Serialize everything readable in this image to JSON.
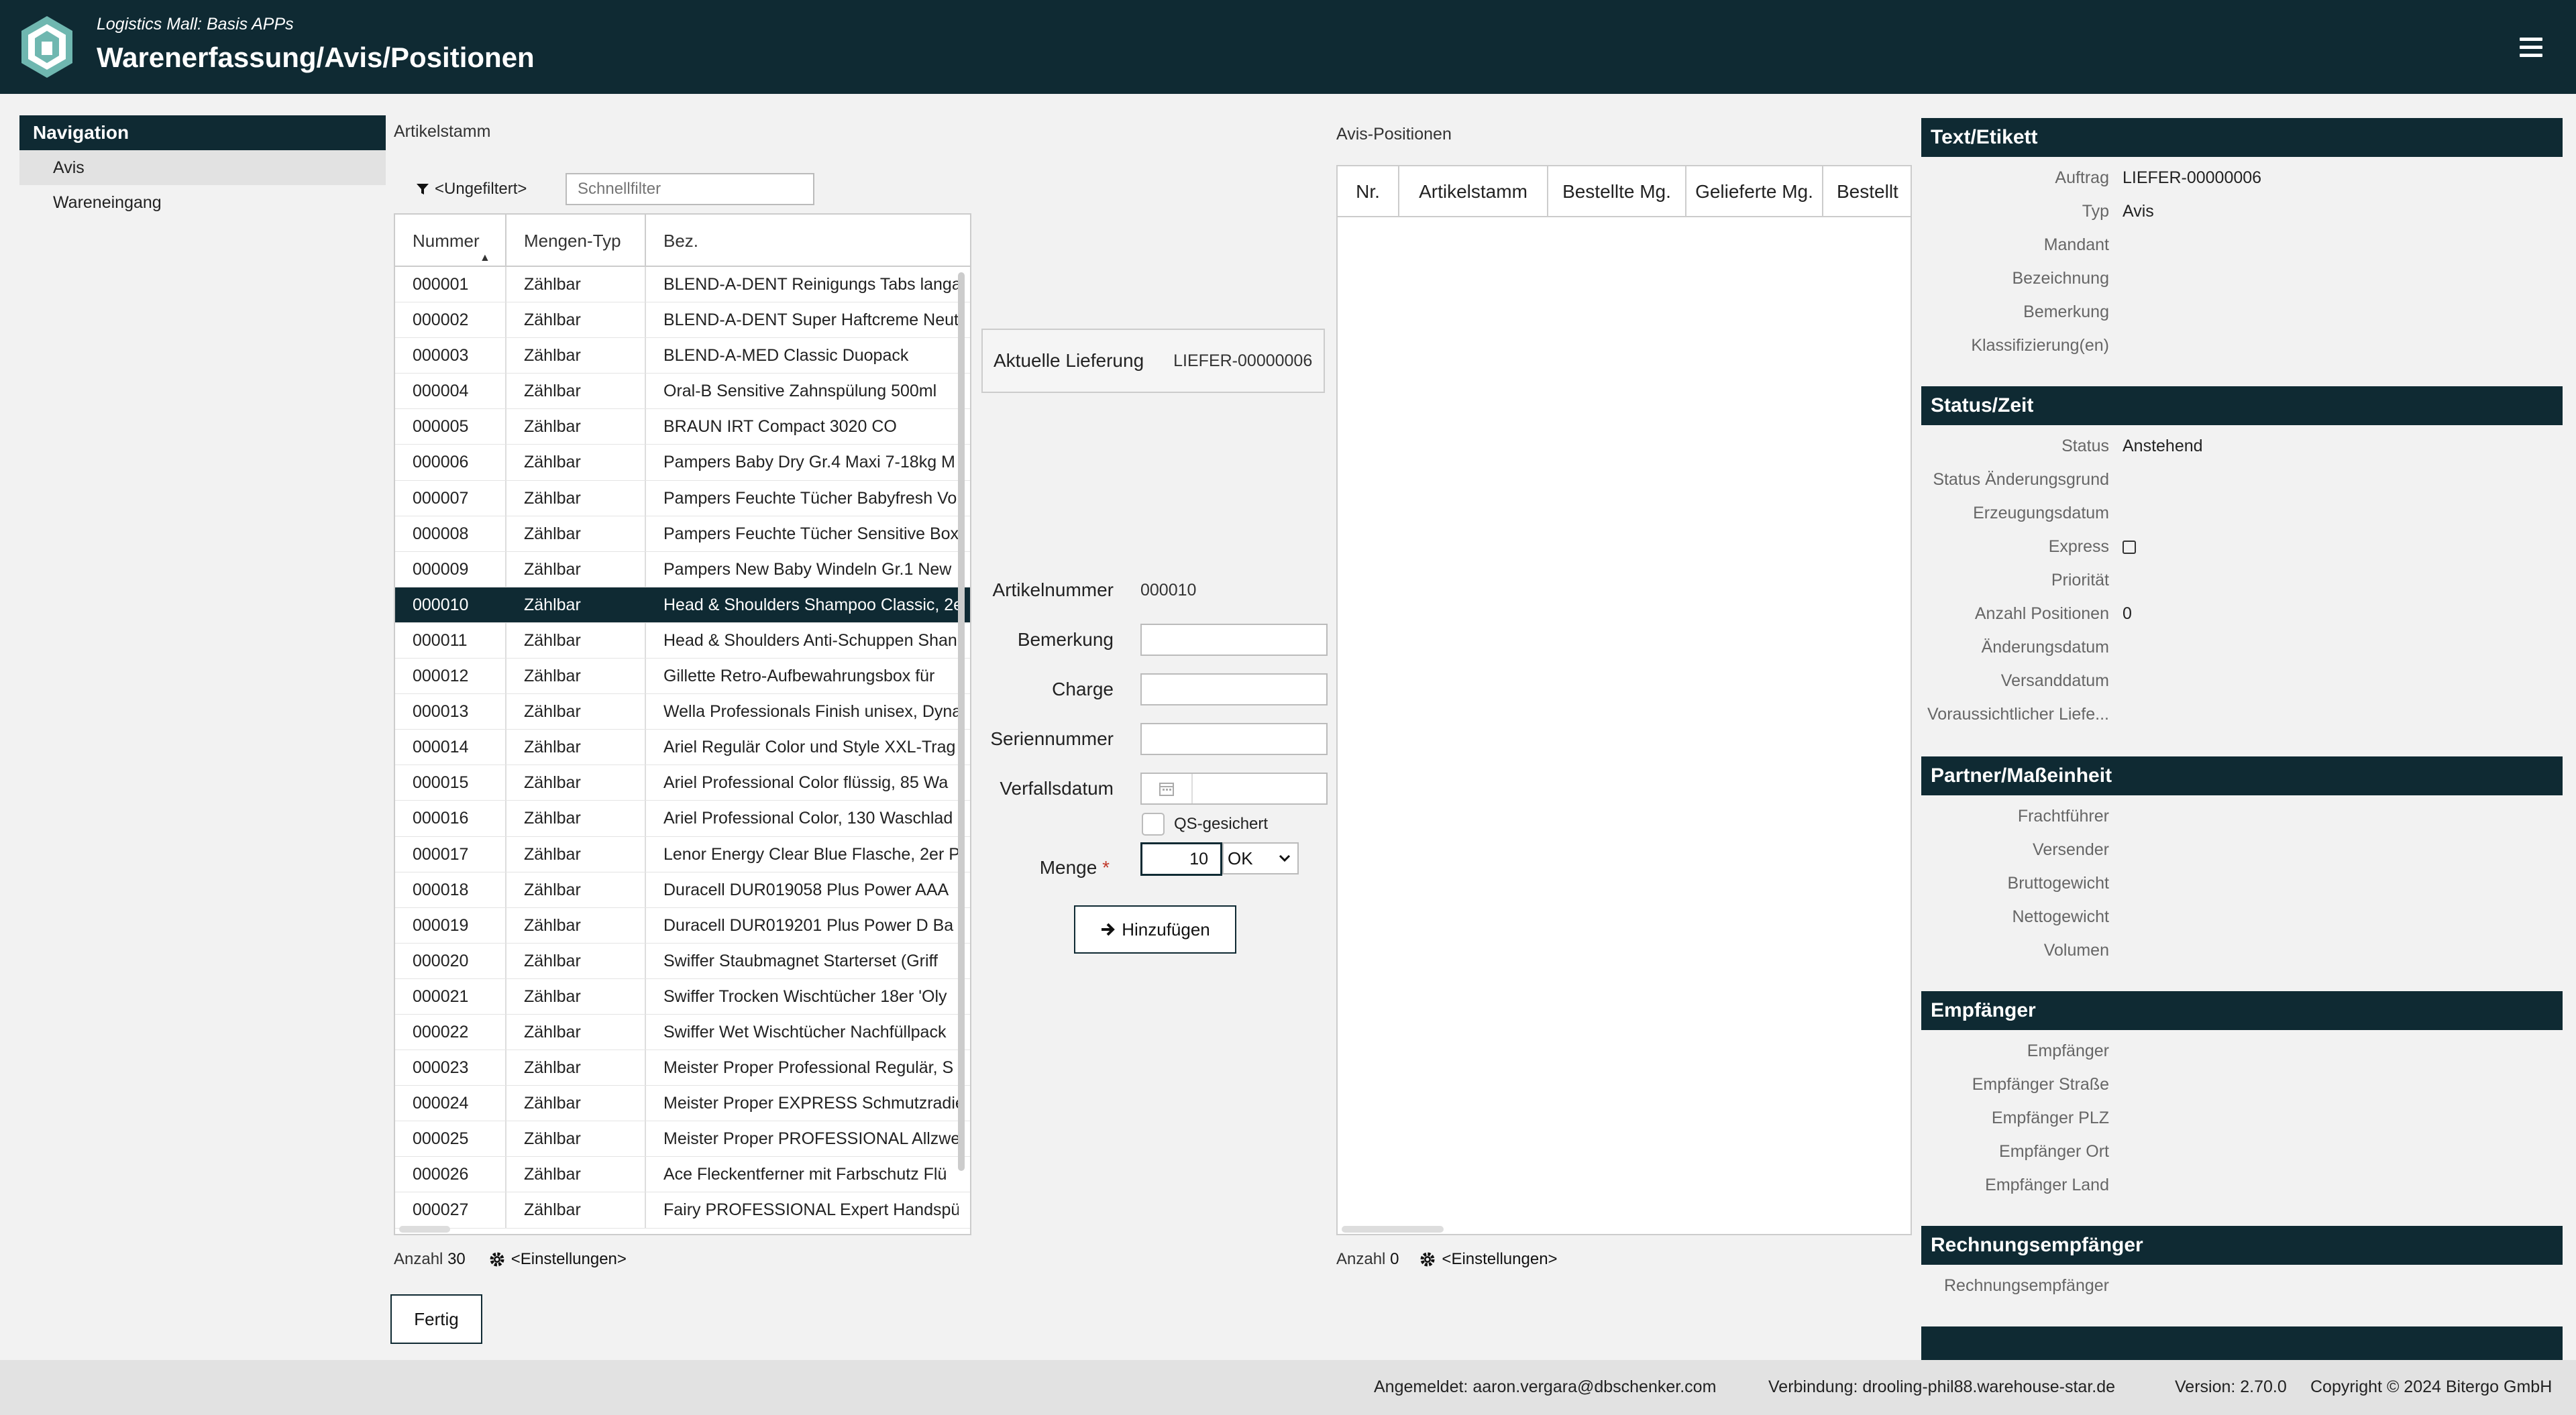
{
  "header": {
    "subtitle": "Logistics Mall: Basis APPs",
    "title": "Warenerfassung/Avis/Positionen"
  },
  "nav": {
    "heading": "Navigation",
    "items": [
      "Avis",
      "Wareneingang"
    ]
  },
  "artikelstamm": {
    "label": "Artikelstamm",
    "filter_label": "<Ungefiltert>",
    "quick_filter_placeholder": "Schnellfilter",
    "columns": [
      "Nummer",
      "Mengen-Typ",
      "Bez."
    ],
    "rows": [
      [
        "000001",
        "Zählbar",
        "BLEND-A-DENT Reinigungs Tabs langa"
      ],
      [
        "000002",
        "Zählbar",
        "BLEND-A-DENT Super Haftcreme Neut"
      ],
      [
        "000003",
        "Zählbar",
        "BLEND-A-MED Classic Duopack"
      ],
      [
        "000004",
        "Zählbar",
        "Oral-B Sensitive Zahnspülung 500ml"
      ],
      [
        "000005",
        "Zählbar",
        "BRAUN IRT Compact 3020 CO"
      ],
      [
        "000006",
        "Zählbar",
        "Pampers Baby Dry Gr.4 Maxi 7-18kg M"
      ],
      [
        "000007",
        "Zählbar",
        "Pampers Feuchte Tücher Babyfresh Vo"
      ],
      [
        "000008",
        "Zählbar",
        "Pampers Feuchte Tücher Sensitive Box"
      ],
      [
        "000009",
        "Zählbar",
        "Pampers New Baby Windeln Gr.1 New"
      ],
      [
        "000010",
        "Zählbar",
        "Head & Shoulders Shampoo Classic, 2e"
      ],
      [
        "000011",
        "Zählbar",
        "Head & Shoulders Anti-Schuppen Shan"
      ],
      [
        "000012",
        "Zählbar",
        "Gillette Retro-Aufbewahrungsbox für"
      ],
      [
        "000013",
        "Zählbar",
        "Wella Professionals Finish unisex, Dyna"
      ],
      [
        "000014",
        "Zählbar",
        "Ariel Regulär Color und Style XXL-Trag"
      ],
      [
        "000015",
        "Zählbar",
        "Ariel Professional Color flüssig, 85 Wa"
      ],
      [
        "000016",
        "Zählbar",
        "Ariel Professional Color, 130 Waschlad"
      ],
      [
        "000017",
        "Zählbar",
        "Lenor Energy Clear Blue Flasche, 2er P"
      ],
      [
        "000018",
        "Zählbar",
        "Duracell DUR019058 Plus Power AAA"
      ],
      [
        "000019",
        "Zählbar",
        "Duracell DUR019201 Plus Power D Ba"
      ],
      [
        "000020",
        "Zählbar",
        "Swiffer Staubmagnet Starterset (Griff"
      ],
      [
        "000021",
        "Zählbar",
        "Swiffer Trocken Wischtücher 18er 'Oly"
      ],
      [
        "000022",
        "Zählbar",
        "Swiffer Wet Wischtücher Nachfüllpack"
      ],
      [
        "000023",
        "Zählbar",
        "Meister Proper Professional Regulär, S"
      ],
      [
        "000024",
        "Zählbar",
        "Meister Proper EXPRESS Schmutzradie"
      ],
      [
        "000025",
        "Zählbar",
        "Meister Proper PROFESSIONAL Allzwe"
      ],
      [
        "000026",
        "Zählbar",
        "Ace Fleckentferner mit Farbschutz Flü"
      ],
      [
        "000027",
        "Zählbar",
        "Fairy PROFESSIONAL Expert Handspül"
      ]
    ],
    "selected_number": "000010",
    "count_label": "Anzahl",
    "count": "30",
    "settings_label": "<Einstellungen>"
  },
  "form": {
    "aktuelle_lieferung_label": "Aktuelle Lieferung",
    "aktuelle_lieferung_value": "LIEFER-00000006",
    "artikelnummer_label": "Artikelnummer",
    "artikelnummer_value": "000010",
    "bemerkung_label": "Bemerkung",
    "charge_label": "Charge",
    "seriennummer_label": "Seriennummer",
    "verfallsdatum_label": "Verfallsdatum",
    "qs_label": "QS-gesichert",
    "menge_label": "Menge",
    "required_marker": "*",
    "menge_value": "10",
    "status_option": "OK",
    "add_button": "Hinzufügen"
  },
  "fertig_button": "Fertig",
  "avis_positionen": {
    "label": "Avis-Positionen",
    "columns": [
      "Nr.",
      "Artikelstamm",
      "Bestellte Mg.",
      "Gelieferte Mg.",
      "Bestellt"
    ],
    "count_label": "Anzahl",
    "count": "0",
    "settings_label": "<Einstellungen>"
  },
  "detail": {
    "sections": [
      {
        "title": "Text/Etikett",
        "fields": [
          {
            "k": "Auftrag",
            "v": "LIEFER-00000006"
          },
          {
            "k": "Typ",
            "v": "Avis"
          },
          {
            "k": "Mandant",
            "v": ""
          },
          {
            "k": "Bezeichnung",
            "v": ""
          },
          {
            "k": "Bemerkung",
            "v": ""
          },
          {
            "k": "Klassifizierung(en)",
            "v": ""
          }
        ]
      },
      {
        "title": "Status/Zeit",
        "fields": [
          {
            "k": "Status",
            "v": "Anstehend"
          },
          {
            "k": "Status Änderungsgrund",
            "v": ""
          },
          {
            "k": "Erzeugungsdatum",
            "v": ""
          },
          {
            "k": "Express",
            "v": "",
            "checkbox": true
          },
          {
            "k": "Priorität",
            "v": ""
          },
          {
            "k": "Anzahl Positionen",
            "v": "0"
          },
          {
            "k": "Änderungsdatum",
            "v": ""
          },
          {
            "k": "Versanddatum",
            "v": ""
          },
          {
            "k": "Voraussichtlicher Liefe...",
            "v": ""
          }
        ]
      },
      {
        "title": "Partner/Maßeinheit",
        "fields": [
          {
            "k": "Frachtführer",
            "v": ""
          },
          {
            "k": "Versender",
            "v": ""
          },
          {
            "k": "Bruttogewicht",
            "v": ""
          },
          {
            "k": "Nettogewicht",
            "v": ""
          },
          {
            "k": "Volumen",
            "v": ""
          }
        ]
      },
      {
        "title": "Empfänger",
        "fields": [
          {
            "k": "Empfänger",
            "v": ""
          },
          {
            "k": "Empfänger Straße",
            "v": ""
          },
          {
            "k": "Empfänger PLZ",
            "v": ""
          },
          {
            "k": "Empfänger Ort",
            "v": ""
          },
          {
            "k": "Empfänger Land",
            "v": ""
          }
        ]
      },
      {
        "title": "Rechnungsempfänger",
        "fields": [
          {
            "k": "Rechnungsempfänger",
            "v": ""
          }
        ]
      }
    ]
  },
  "statusbar": {
    "login": "Angemeldet: aaron.vergara@dbschenker.com",
    "connection": "Verbindung: drooling-phil88.warehouse-star.de",
    "version": "Version: 2.70.0",
    "copyright": "Copyright © 2024 Bitergo GmbH"
  },
  "colors": {
    "header_bg": "#0f2a33",
    "selected_row": "#0f2a33",
    "required": "#c0392b"
  }
}
